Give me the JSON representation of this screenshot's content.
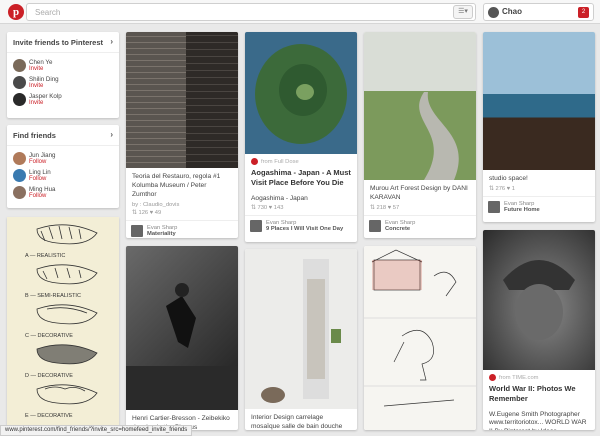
{
  "header": {
    "logo_letter": "p",
    "search_placeholder": "Search",
    "user_name": "Chao",
    "notification_count": "2"
  },
  "invite_card": {
    "title": "Invite friends to Pinterest",
    "people": [
      {
        "name": "Chen Ye",
        "action": "Invite"
      },
      {
        "name": "Shilin Ding",
        "action": "Invite"
      },
      {
        "name": "Jasper Kolp",
        "action": "Invite"
      }
    ]
  },
  "find_card": {
    "title": "Find friends",
    "people": [
      {
        "name": "Jun Jiang",
        "action": "Follow"
      },
      {
        "name": "Ling Lin",
        "action": "Follow"
      },
      {
        "name": "Ming Hua",
        "action": "Follow"
      }
    ]
  },
  "pins": [
    {
      "desc": "Teoria del Restauro, regola #1 Kolumba Museum / Peter Zumthor",
      "via": "by : Claudio_dovis",
      "stats": "⇅ 126   ♥ 49",
      "owner": "Evan Sharp",
      "board": "Materiality"
    },
    {
      "source": "from Full Dose",
      "title": "Aogashima - Japan - A Must Visit Place Before You Die",
      "desc": "Aogashima - Japan",
      "stats": "⇅ 730   ♥ 143",
      "owner": "Evan Sharp",
      "board": "9 Places I Will Visit One Day"
    },
    {
      "desc": "Murou Art Forest Design by DANI KARAVAN",
      "stats": "⇅ 218   ♥ 57",
      "owner": "Evan Sharp",
      "board": "Concrete"
    },
    {
      "desc": "studio space!",
      "stats": "⇅ 276   ♥ 1",
      "owner": "Evan Sharp",
      "board": "Future Home"
    },
    {
      "desc": "Henri Cartier-Bresson - Zeibekiko dancing in the Piraeus"
    },
    {
      "desc": "Interior Design carrelage mosaïque salle de bain douche serviette"
    },
    {
      "source": "from TIME.com",
      "title": "World War II: Photos We Remember",
      "desc": "W.Eugene Smith Photographer www.territoriotox... WORLD WAR II By Pinterest by Ideas"
    }
  ],
  "drawing_labels": [
    "A — REALISTIC",
    "B — SEMI-REALISTIC",
    "C — DECORATIVE",
    "D — DECORATIVE",
    "E — DECORATIVE"
  ],
  "status_url": "www.pinterest.com/find_friends/?invite_src=homefeed_invite_friends"
}
